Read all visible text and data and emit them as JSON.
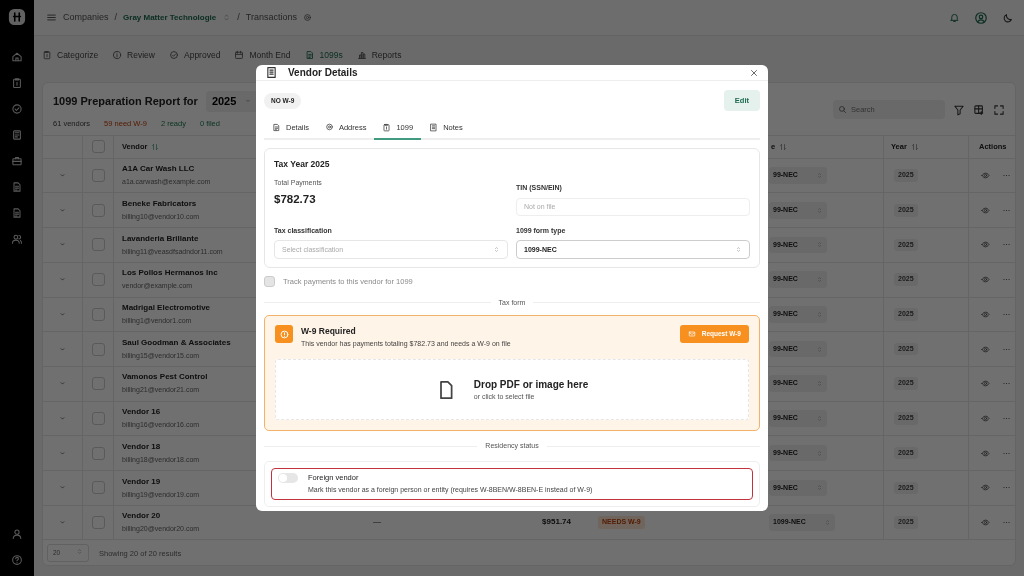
{
  "breadcrumb": {
    "root": "Companies",
    "separator_1": "/",
    "company": "Gray Matter Technologie",
    "separator_2": "/",
    "page": "Transactions"
  },
  "nav_tabs": [
    {
      "label": "Categorize",
      "selected": false
    },
    {
      "label": "Review",
      "selected": false
    },
    {
      "label": "Approved",
      "selected": false
    },
    {
      "label": "Month End",
      "selected": false
    },
    {
      "label": "1099s",
      "selected": true
    },
    {
      "label": "Reports",
      "selected": false
    }
  ],
  "report": {
    "title": "1099 Preparation Report for",
    "year": "2025",
    "search": {
      "placeholder": "Search"
    },
    "stats": [
      {
        "text": "61 vendors",
        "kind": "neutral"
      },
      {
        "text": "59 need W-9",
        "kind": "warning"
      },
      {
        "text": "2 ready",
        "kind": "success"
      },
      {
        "text": "0 filed",
        "kind": "success"
      }
    ]
  },
  "table": {
    "select_all_checked": false,
    "columns": [
      {
        "label": "Vendor",
        "sortable": true
      },
      {
        "label": "e",
        "sortable": true
      },
      {
        "label": "Year",
        "sortable": true
      },
      {
        "label": "Actions",
        "sortable": false
      }
    ],
    "rows": [
      {
        "name": "A1A Car Wash LLC",
        "email": "a1a.carwash@example.com",
        "checked": false,
        "form_type": "99-NEC",
        "year": "2025"
      },
      {
        "name": "Beneke Fabricators",
        "email": "billing10@vendor10.com",
        "checked": false,
        "form_type": "99-NEC",
        "year": "2025"
      },
      {
        "name": "Lavanderia Brillante",
        "email": "billing11@veasdfsadndor11.com",
        "checked": false,
        "form_type": "99-NEC",
        "year": "2025"
      },
      {
        "name": "Los Pollos Hermanos Inc",
        "email": "vendor@example.com",
        "checked": false,
        "form_type": "99-NEC",
        "year": "2025"
      },
      {
        "name": "Madrigal Electromotive",
        "email": "billing1@vendor1.com",
        "checked": false,
        "form_type": "99-NEC",
        "year": "2025"
      },
      {
        "name": "Saul Goodman & Associates",
        "email": "billing15@vendor15.com",
        "checked": false,
        "form_type": "99-NEC",
        "year": "2025"
      },
      {
        "name": "Vamonos Pest Control",
        "email": "billing21@vendor21.com",
        "checked": false,
        "form_type": "99-NEC",
        "year": "2025"
      },
      {
        "name": "Vendor 16",
        "email": "billing16@vendor16.com",
        "checked": false,
        "form_type": "99-NEC",
        "year": "2025"
      },
      {
        "name": "Vendor 18",
        "email": "billing18@vendor18.com",
        "checked": false,
        "form_type": "99-NEC",
        "year": "2025"
      },
      {
        "name": "Vendor 19",
        "email": "billing19@vendor19.com",
        "checked": false,
        "form_type": "99-NEC",
        "year": "2025"
      },
      {
        "name": "Vendor 20",
        "email": "billing20@vendor20.com",
        "checked": false,
        "tin": "—",
        "total": "$951.74",
        "status": "NEEDS W-9",
        "form_type": "1099-NEC",
        "year": "2025"
      }
    ]
  },
  "footer": {
    "page_size": "20",
    "summary": "Showing 20 of 20 results"
  },
  "modal": {
    "title": "Vendor Details",
    "badge": "NO W-9",
    "edit": "Edit",
    "tabs": [
      {
        "label": "Details",
        "selected": false
      },
      {
        "label": "Address",
        "selected": false
      },
      {
        "label": "1099",
        "selected": true
      },
      {
        "label": "Notes",
        "selected": false
      }
    ],
    "tax_year": "Tax Year 2025",
    "total_label": "Total Payments",
    "total": "$782.73",
    "tin": {
      "label": "TIN (SSN/EIN)",
      "placeholder": "Not on file"
    },
    "classification": {
      "label": "Tax classification",
      "placeholder": "Select classification"
    },
    "form_type": {
      "label": "1099 form type",
      "value": "1099-NEC"
    },
    "track": {
      "label": "Track payments to this vendor for 1099",
      "checked": false,
      "disabled": true
    },
    "tax_form_divider": "Tax form",
    "alert": {
      "title": "W-9 Required",
      "message": "This vendor has payments totaling $782.73 and needs a W-9 on file",
      "button": "Request W-9"
    },
    "dropzone": {
      "title": "Drop PDF or image here",
      "hint": "or click to select file"
    },
    "residency_divider": "Residency status",
    "foreign": {
      "label": "Foreign vendor",
      "description": "Mark this vendor as a foreign person or entity (requires W-8BEN/W-8BEN-E instead of W-9)",
      "on": false,
      "highlighted": true
    }
  }
}
